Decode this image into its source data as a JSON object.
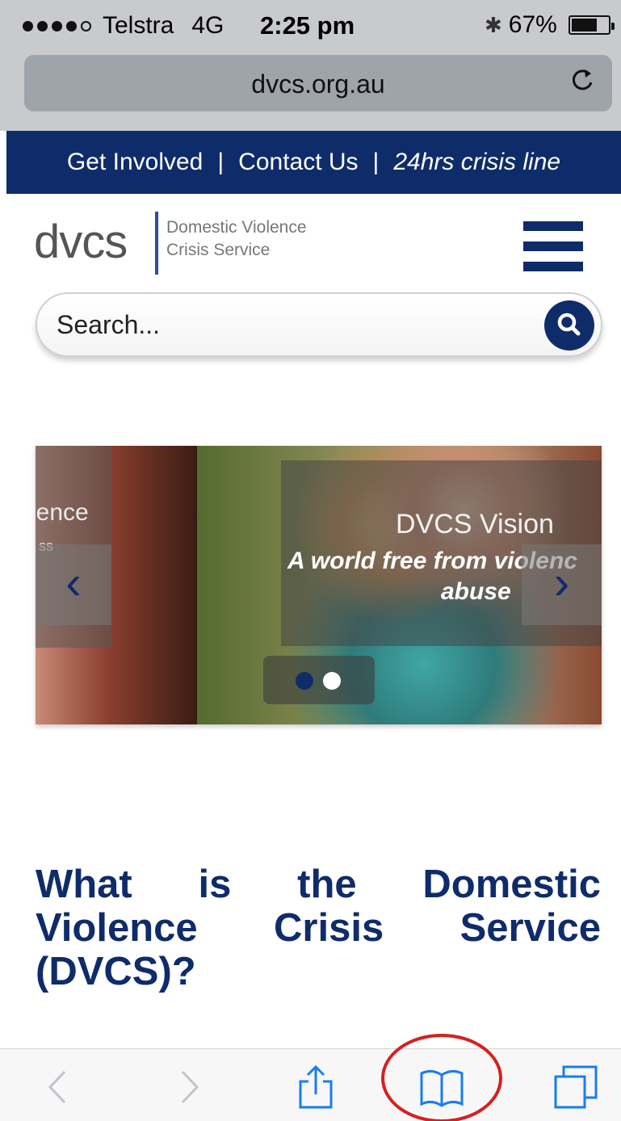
{
  "status_bar": {
    "carrier": "Telstra",
    "network": "4G",
    "time": "2:25 pm",
    "battery": "67%",
    "battery_level": 0.67,
    "signal_dots_filled": 4,
    "signal_dots_total": 5
  },
  "browser": {
    "url": "dvcs.org.au",
    "reload_icon": "reload-icon"
  },
  "top_nav": {
    "items": [
      "Get Involved",
      "Contact Us",
      "24hrs crisis line"
    ],
    "separator": "|"
  },
  "logo": {
    "wordmark": "dvcs",
    "line1": "Domestic Violence",
    "line2": "Crisis Service"
  },
  "search": {
    "placeholder": "Search..."
  },
  "carousel": {
    "partial_prev_text": "lence",
    "partial_prev_sub": "ss",
    "slide_title": "DVCS Vision",
    "slide_quote_line1": "A world free from violenc",
    "slide_quote_line2": "abuse",
    "prev_glyph": "‹",
    "next_glyph": "›",
    "page_count": 2,
    "active_page": 1
  },
  "main": {
    "heading": "What is the Domestic Violence Crisis Service (DVCS)?"
  },
  "colors": {
    "brand_navy": "#0f2c6a",
    "annotation_red": "#d81f1f"
  }
}
